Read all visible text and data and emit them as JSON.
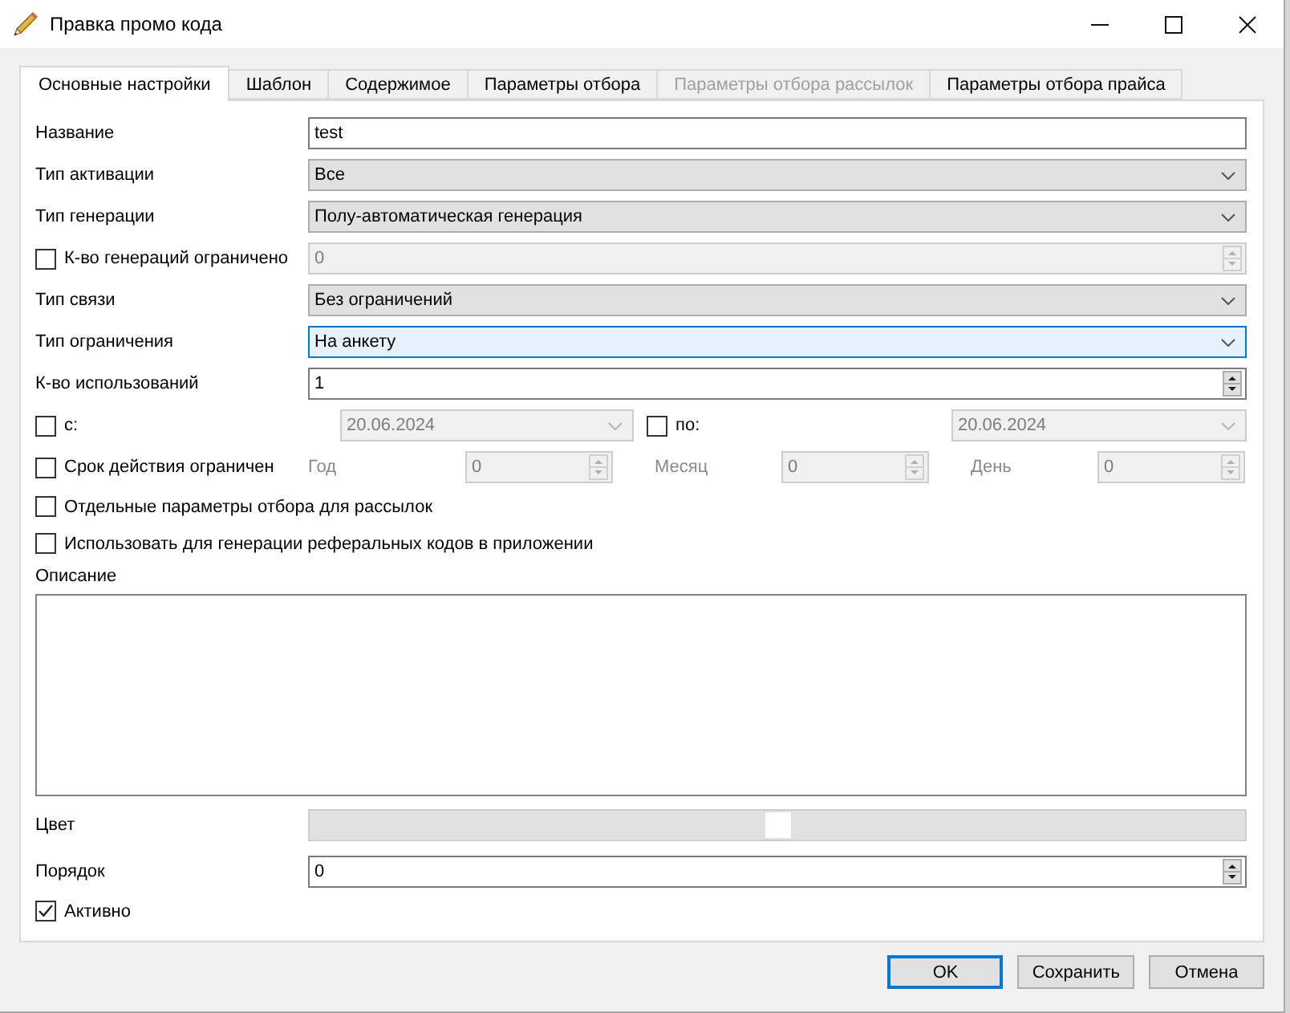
{
  "window": {
    "title": "Правка промо кода"
  },
  "tabs": [
    {
      "label": "Основные настройки",
      "selected": true,
      "disabled": false
    },
    {
      "label": "Шаблон",
      "selected": false,
      "disabled": false
    },
    {
      "label": "Содержимое",
      "selected": false,
      "disabled": false
    },
    {
      "label": "Параметры отбора",
      "selected": false,
      "disabled": false
    },
    {
      "label": "Параметры отбора рассылок",
      "selected": false,
      "disabled": true
    },
    {
      "label": "Параметры отбора прайса",
      "selected": false,
      "disabled": false
    }
  ],
  "form": {
    "rows": [
      {
        "kind": "text",
        "label": "Название",
        "value": "test"
      },
      {
        "kind": "combo",
        "label": "Тип активации",
        "value": "Все",
        "focused": false
      },
      {
        "kind": "combo",
        "label": "Тип генерации",
        "value": "Полу-автоматическая генерация",
        "focused": false
      },
      {
        "kind": "check_spin",
        "label": "К-во генераций ограничено",
        "checked": false,
        "value": "0"
      },
      {
        "kind": "combo",
        "label": "Тип связи",
        "value": "Без ограничений",
        "focused": false
      },
      {
        "kind": "combo",
        "label": "Тип ограничения",
        "value": "На анкету",
        "focused": true
      },
      {
        "kind": "spin",
        "label": "К-во использований",
        "value": "1"
      },
      {
        "kind": "date_range",
        "from": {
          "label": "с:",
          "checked": false,
          "value": "20.06.2024"
        },
        "to": {
          "label": "по:",
          "checked": false,
          "value": "20.06.2024"
        }
      },
      {
        "kind": "duration",
        "label": "Срок действия ограничен",
        "checked": false,
        "parts": [
          {
            "label": "Год",
            "value": "0"
          },
          {
            "label": "Месяц",
            "value": "0"
          },
          {
            "label": "День",
            "value": "0"
          }
        ]
      },
      {
        "kind": "check",
        "label": "Отдельные параметры отбора для рассылок",
        "checked": false
      },
      {
        "kind": "check",
        "label": "Использовать для генерации реферальных кодов в приложении",
        "checked": false
      },
      {
        "kind": "memo",
        "label": "Описание"
      },
      {
        "kind": "color",
        "label": "Цвет",
        "color": "#ffffff"
      },
      {
        "kind": "spin",
        "label": "Порядок",
        "value": "0"
      },
      {
        "kind": "check",
        "label": "Активно",
        "checked": true
      }
    ]
  },
  "buttons": [
    {
      "label": "OK",
      "default": true
    },
    {
      "label": "Сохранить",
      "default": false
    },
    {
      "label": "Отмена",
      "default": false
    }
  ]
}
